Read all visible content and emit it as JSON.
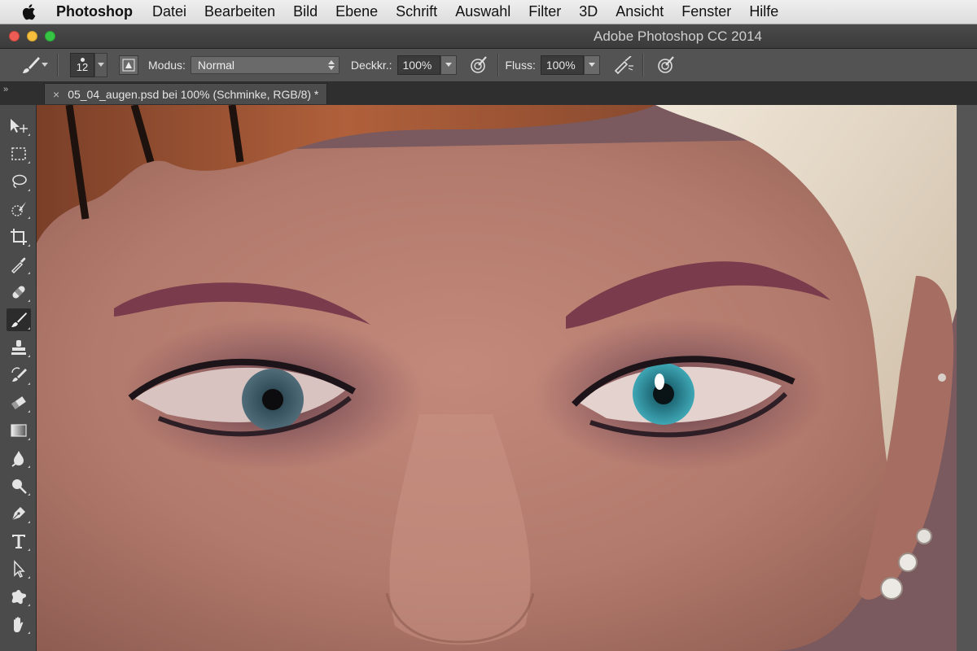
{
  "menubar": {
    "apple_icon": "apple-icon",
    "items": [
      "Photoshop",
      "Datei",
      "Bearbeiten",
      "Bild",
      "Ebene",
      "Schrift",
      "Auswahl",
      "Filter",
      "3D",
      "Ansicht",
      "Fenster",
      "Hilfe"
    ]
  },
  "window": {
    "title": "Adobe Photoshop CC 2014"
  },
  "options": {
    "brush_size": "12",
    "mode_label": "Modus:",
    "mode_value": "Normal",
    "opacity_label": "Deckkr.:",
    "opacity_value": "100%",
    "flow_label": "Fluss:",
    "flow_value": "100%"
  },
  "document": {
    "tab_close": "×",
    "tab_title": "05_04_augen.psd bei 100% (Schminke, RGB/8) *"
  },
  "panel_collapse": "»",
  "tools": [
    {
      "name": "move-tool-icon",
      "active": false
    },
    {
      "name": "marquee-tool-icon",
      "active": false
    },
    {
      "name": "lasso-tool-icon",
      "active": false
    },
    {
      "name": "quick-selection-tool-icon",
      "active": false
    },
    {
      "name": "crop-tool-icon",
      "active": false
    },
    {
      "name": "eyedropper-tool-icon",
      "active": false
    },
    {
      "name": "healing-brush-tool-icon",
      "active": false
    },
    {
      "name": "brush-tool-icon",
      "active": true
    },
    {
      "name": "clone-stamp-tool-icon",
      "active": false
    },
    {
      "name": "history-brush-tool-icon",
      "active": false
    },
    {
      "name": "eraser-tool-icon",
      "active": false
    },
    {
      "name": "gradient-tool-icon",
      "active": false
    },
    {
      "name": "blur-tool-icon",
      "active": false
    },
    {
      "name": "dodge-tool-icon",
      "active": false
    },
    {
      "name": "pen-tool-icon",
      "active": false
    },
    {
      "name": "type-tool-icon",
      "active": false
    },
    {
      "name": "path-selection-tool-icon",
      "active": false
    },
    {
      "name": "custom-shape-tool-icon",
      "active": false
    },
    {
      "name": "hand-tool-icon",
      "active": false
    }
  ],
  "colors": {
    "skin": "#b07a6e",
    "eyeshadow": "#6e3f5a",
    "iris_right": "#3fa7b5",
    "iris_left": "#4f6c78",
    "hair": "#e7dccb",
    "headwrap": "#8a4a2f"
  }
}
